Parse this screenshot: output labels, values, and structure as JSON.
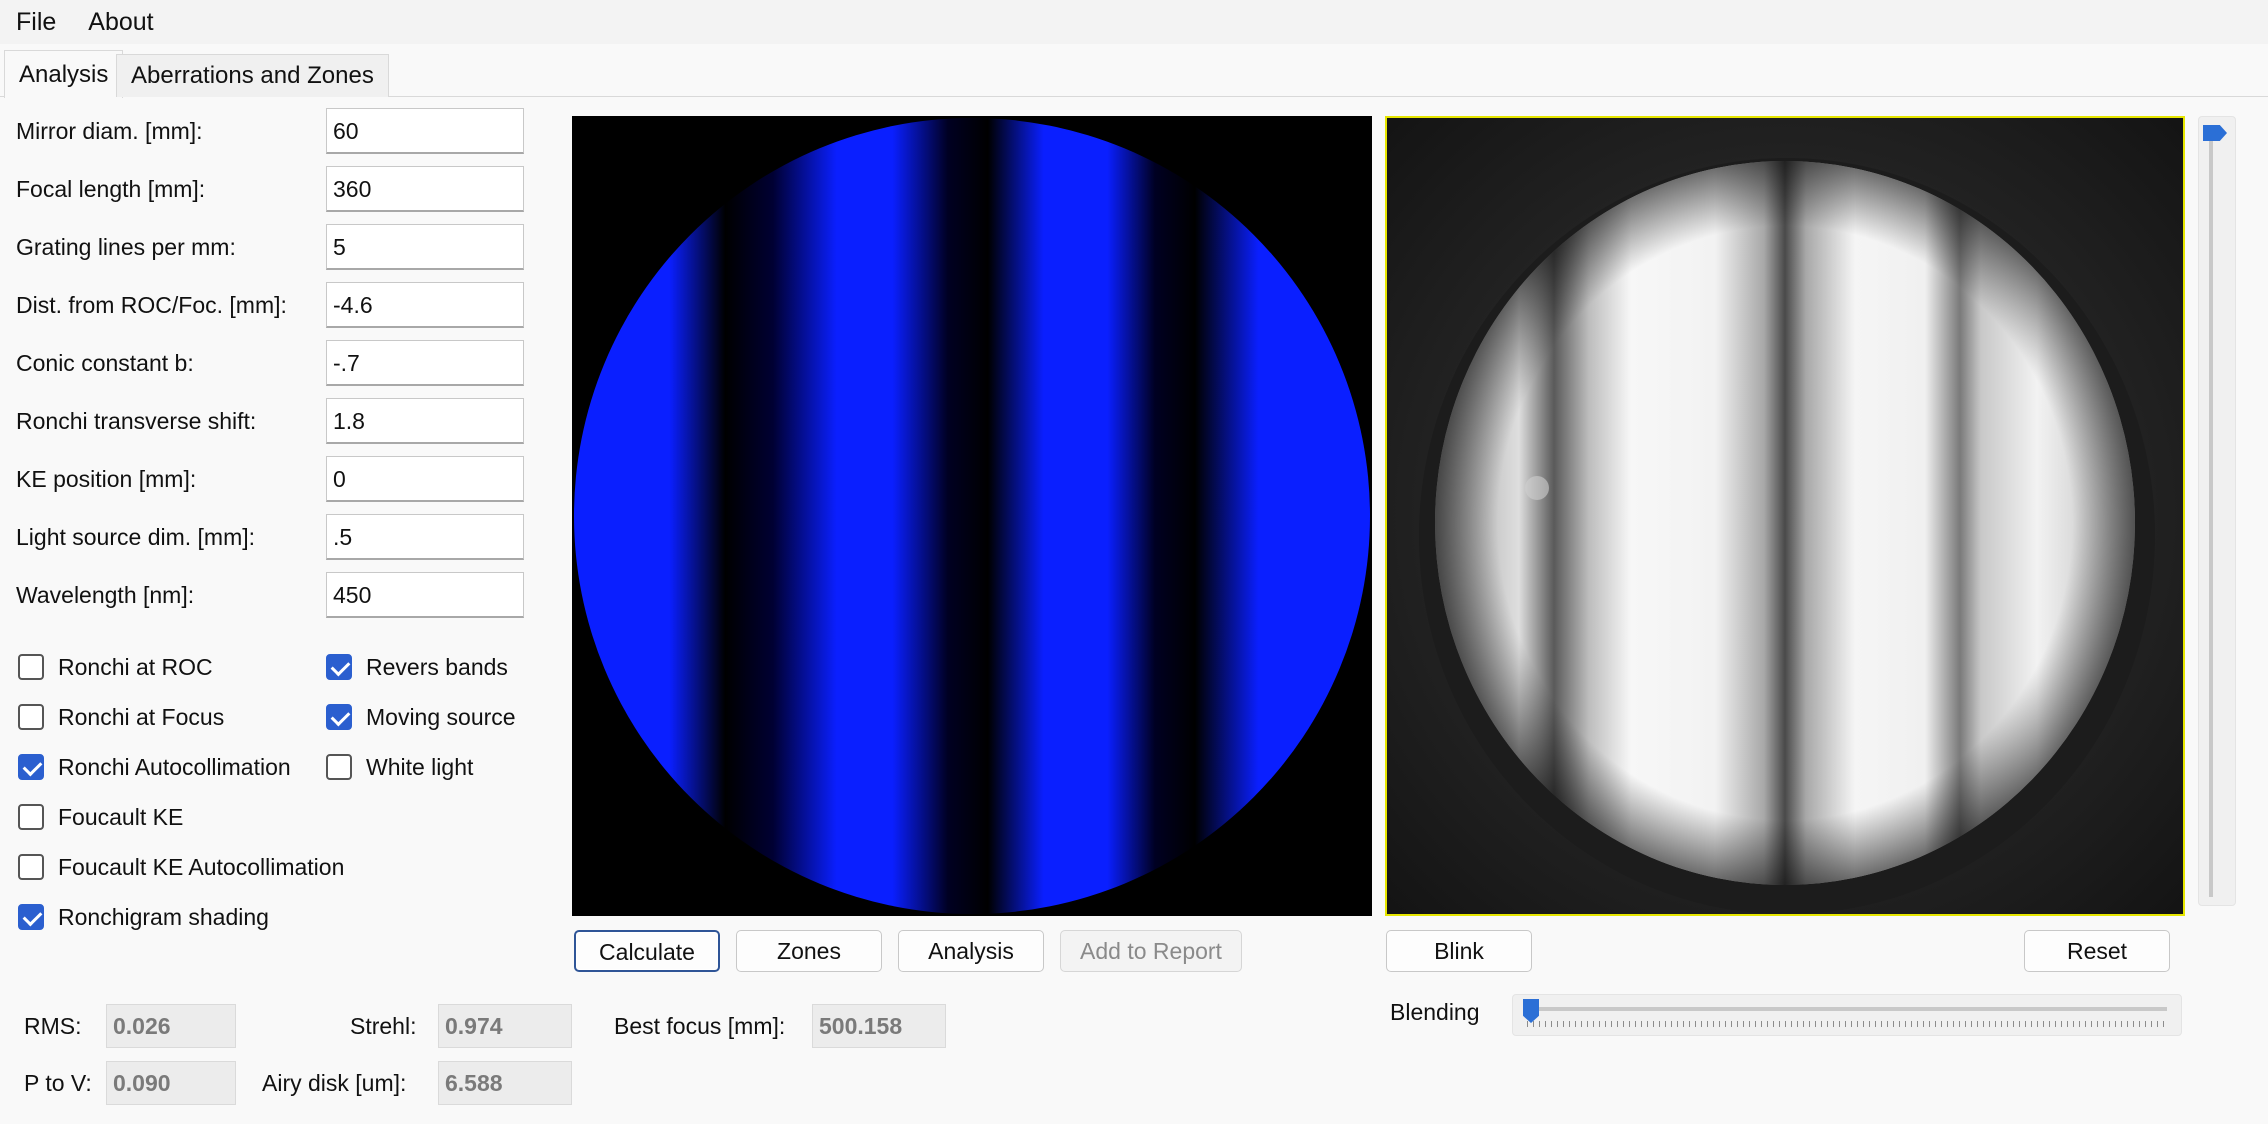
{
  "menu": {
    "file": "File",
    "about": "About"
  },
  "tabs": [
    {
      "label": "Analysis",
      "active": true
    },
    {
      "label": "Aberrations and Zones",
      "active": false
    }
  ],
  "fields": [
    {
      "label": "Mirror diam. [mm]:",
      "value": "60"
    },
    {
      "label": "Focal length [mm]:",
      "value": "360"
    },
    {
      "label": "Grating lines per mm:",
      "value": "5"
    },
    {
      "label": "Dist. from ROC/Foc. [mm]:",
      "value": "-4.6"
    },
    {
      "label": "Conic constant b:",
      "value": "-.7"
    },
    {
      "label": "Ronchi transverse shift:",
      "value": "1.8"
    },
    {
      "label": "KE position [mm]:",
      "value": "0"
    },
    {
      "label": "Light source dim. [mm]:",
      "value": ".5"
    },
    {
      "label": "Wavelength [nm]:",
      "value": "450"
    }
  ],
  "checkboxes": {
    "ronchi_roc": {
      "label": "Ronchi at ROC",
      "checked": false
    },
    "ronchi_focus": {
      "label": "Ronchi at Focus",
      "checked": false
    },
    "ronchi_autocoll": {
      "label": "Ronchi Autocollimation",
      "checked": true
    },
    "foucault_ke": {
      "label": "Foucault KE",
      "checked": false
    },
    "foucault_ke_autocoll": {
      "label": "Foucault KE Autocollimation",
      "checked": false
    },
    "ronchigram_shading": {
      "label": "Ronchigram shading",
      "checked": true
    },
    "revers_bands": {
      "label": "Revers bands",
      "checked": true
    },
    "moving_source": {
      "label": "Moving source",
      "checked": true
    },
    "white_light": {
      "label": "White light",
      "checked": false
    }
  },
  "buttons": {
    "calculate": "Calculate",
    "zones": "Zones",
    "analysis": "Analysis",
    "add_to_report": "Add to Report",
    "blink": "Blink",
    "reset": "Reset"
  },
  "results": {
    "rms_label": "RMS:",
    "rms_value": "0.026",
    "ptov_label": "P to V:",
    "ptov_value": "0.090",
    "strehl_label": "Strehl:",
    "strehl_value": "0.974",
    "airy_label": "Airy disk [um]:",
    "airy_value": "6.588",
    "best_focus_label": "Best focus [mm]:",
    "best_focus_value": "500.158"
  },
  "blending": {
    "label": "Blending",
    "level": 0
  },
  "colors": {
    "simulation_band": "#0a1fff",
    "simulation_dark": "#000000",
    "accent": "#2b5fcf",
    "photo_border": "#e6e600"
  },
  "icons": {
    "simulated_ronchigram": "simulated-ronchigram-image",
    "photo_ronchigram": "photo-ronchigram-image"
  }
}
